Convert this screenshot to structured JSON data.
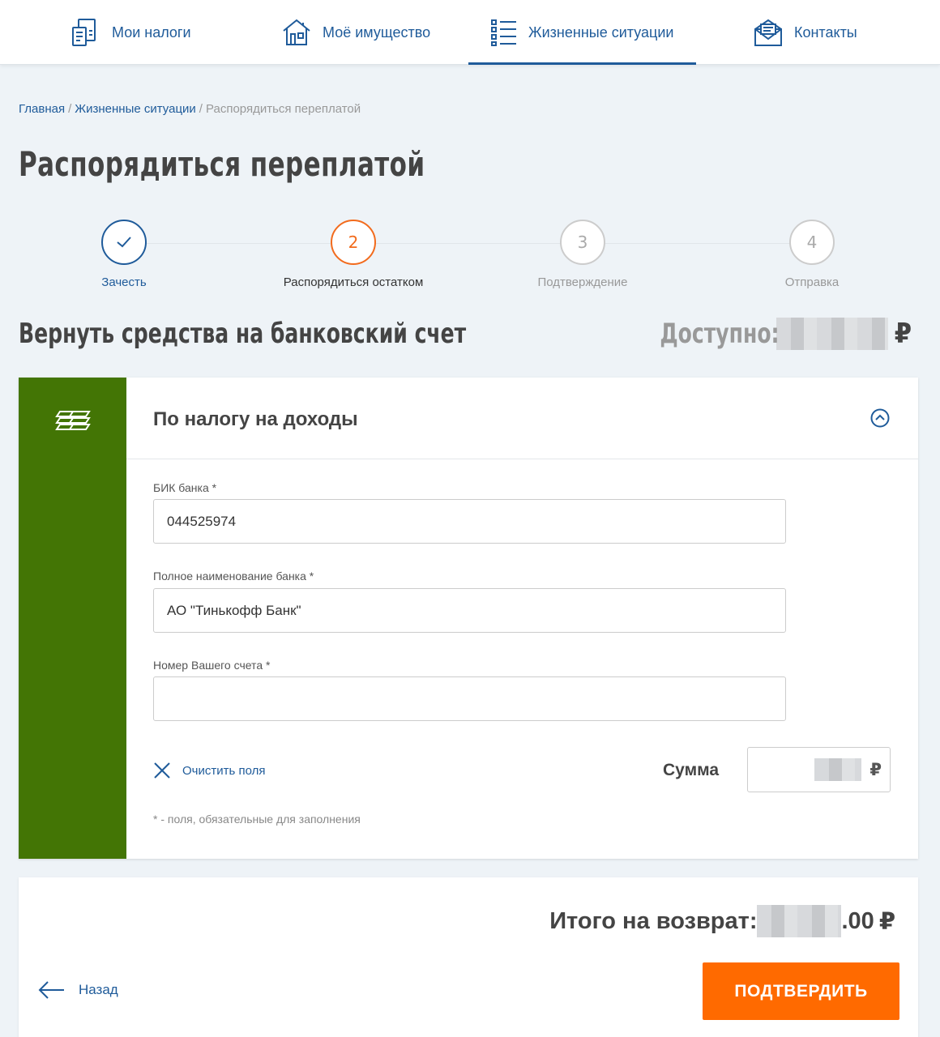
{
  "nav": {
    "items": [
      {
        "label": "Мои налоги",
        "icon": "documents-icon"
      },
      {
        "label": "Моё имущество",
        "icon": "house-icon"
      },
      {
        "label": "Жизненные ситуации",
        "icon": "list-icon",
        "active": true
      },
      {
        "label": "Контакты",
        "icon": "envelope-icon"
      }
    ]
  },
  "breadcrumb": {
    "home": "Главная",
    "sep": "/",
    "life": "Жизненные ситуации",
    "current": "Распорядиться переплатой"
  },
  "page": {
    "title": "Распорядиться переплатой"
  },
  "steps": [
    {
      "number": "✓",
      "label": "Зачесть",
      "state": "done"
    },
    {
      "number": "2",
      "label": "Распорядиться остатком",
      "state": "current"
    },
    {
      "number": "3",
      "label": "Подтверждение",
      "state": "pending"
    },
    {
      "number": "4",
      "label": "Отправка",
      "state": "pending"
    }
  ],
  "section": {
    "title": "Вернуть средства на банковский счет"
  },
  "available": {
    "label": "Доступно:",
    "currency": "₽"
  },
  "card": {
    "title": "По налогу на доходы",
    "fields": {
      "bik_label": "БИК банка *",
      "bik_value": "044525974",
      "bank_label": "Полное наименование банка *",
      "bank_value": "АО \"Тинькофф Банк\"",
      "account_label": "Номер Вашего счета *",
      "account_value": ""
    },
    "clear_label": "Очистить поля",
    "sum_label": "Сумма",
    "currency": "₽",
    "required_note": "* - поля, обязательные для заполнения"
  },
  "footer": {
    "total_label": "Итого на возврат:",
    "total_suffix": ".00",
    "currency": "₽",
    "back_label": "Назад",
    "confirm_label": "ПОДТВЕРДИТЬ"
  },
  "colors": {
    "primary": "#1f5b9a",
    "accent": "#ff6a00",
    "card_side": "#437505",
    "step_current": "#f26b1d"
  }
}
